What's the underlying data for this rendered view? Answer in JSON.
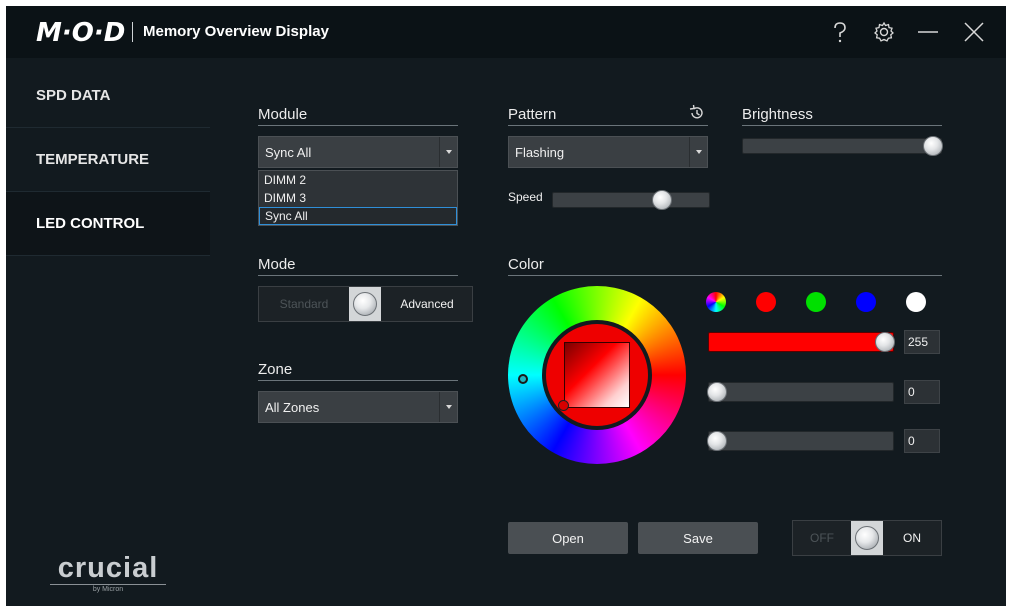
{
  "app": {
    "logo": "M·O·D",
    "title": "Memory Overview Display"
  },
  "titlebar": {
    "help_icon": "help-icon",
    "settings_icon": "gear-icon",
    "minimize_icon": "minimize-icon",
    "close_icon": "close-icon"
  },
  "sidebar": {
    "items": [
      {
        "label": "SPD DATA",
        "active": false
      },
      {
        "label": "TEMPERATURE",
        "active": false
      },
      {
        "label": "LED CONTROL",
        "active": true
      }
    ],
    "brand": {
      "name": "crucial",
      "sub": "by Micron"
    }
  },
  "module": {
    "label": "Module",
    "selected": "Sync All",
    "options": [
      "DIMM 2",
      "DIMM 3",
      "Sync All"
    ]
  },
  "mode": {
    "label": "Mode",
    "off_label": "Standard",
    "on_label": "Advanced",
    "value": "Advanced"
  },
  "zone": {
    "label": "Zone",
    "selected": "All Zones"
  },
  "pattern": {
    "label": "Pattern",
    "selected": "Flashing",
    "history_icon": "history-icon"
  },
  "speed": {
    "label": "Speed",
    "level": 0.72
  },
  "brightness": {
    "label": "Brightness",
    "level": 1.0
  },
  "color": {
    "label": "Color",
    "swatches": [
      "#ff0000",
      "#00e000",
      "#0000ff",
      "#ffffff"
    ],
    "hue_ring_icon": "color-wheel-icon",
    "rgb": {
      "r": "255",
      "g": "0",
      "b": "0"
    },
    "accent": "#ff0000"
  },
  "actions": {
    "open_label": "Open",
    "save_label": "Save"
  },
  "power": {
    "off_label": "OFF",
    "on_label": "ON",
    "value": "ON"
  }
}
